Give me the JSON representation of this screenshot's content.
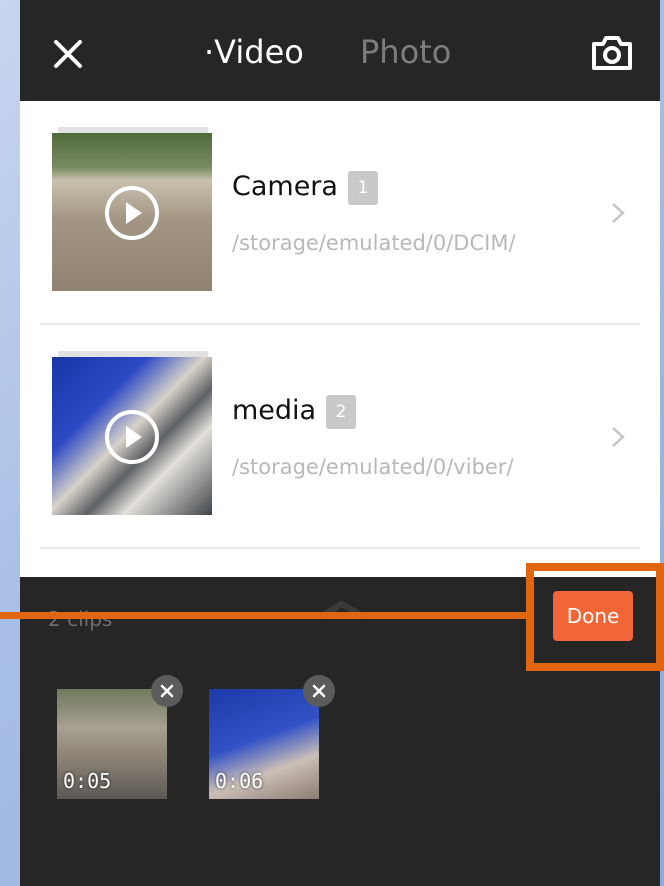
{
  "header": {
    "tab_video": "·Video",
    "tab_photo": "Photo"
  },
  "albums": [
    {
      "name": "Camera",
      "count": "1",
      "path": "/storage/emulated/0/DCIM/"
    },
    {
      "name": "media",
      "count": "2",
      "path": "/storage/emulated/0/viber/"
    }
  ],
  "tray": {
    "clips_label": "2 clips",
    "done_label": "Done",
    "clips": [
      {
        "duration": "0:05"
      },
      {
        "duration": "0:06"
      }
    ]
  },
  "colors": {
    "accent": "#f26536",
    "annotation": "#e2650f",
    "topbar": "#262626"
  }
}
